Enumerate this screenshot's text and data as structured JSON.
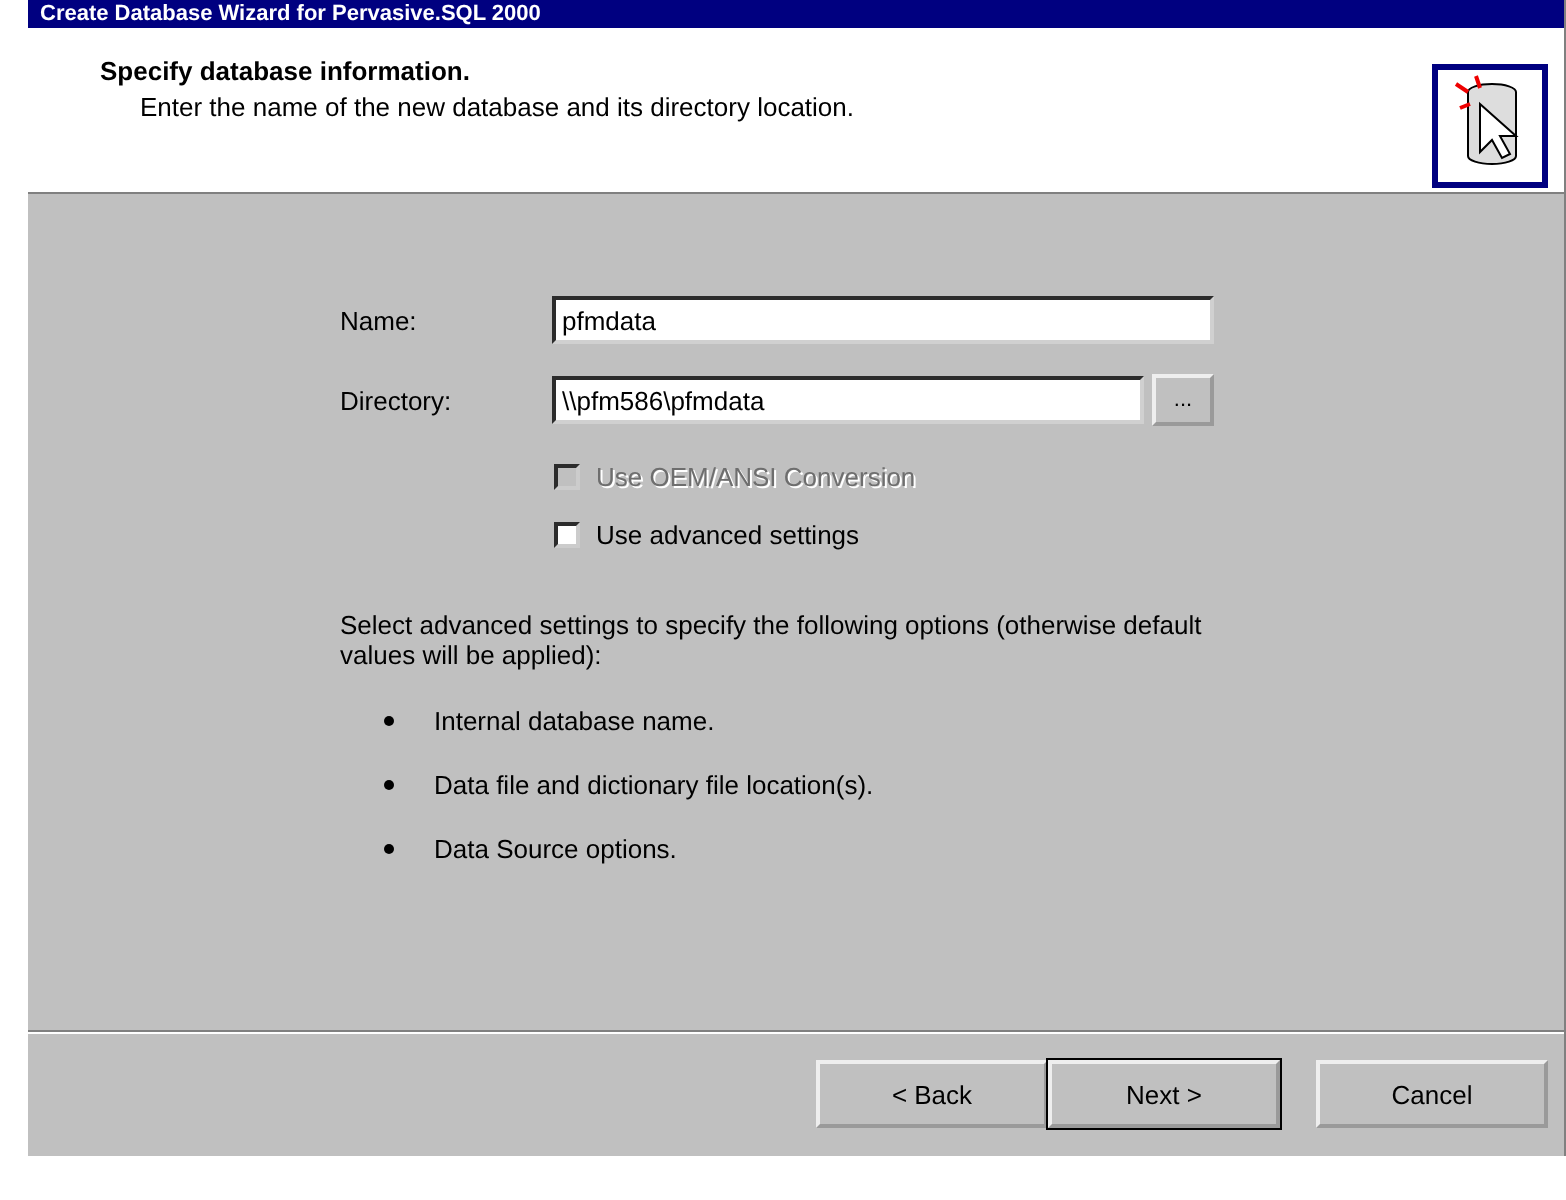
{
  "window": {
    "title": "Create Database Wizard for Pervasive.SQL 2000"
  },
  "header": {
    "title": "Specify database information.",
    "subtitle": "Enter the name of the new database and its directory location."
  },
  "fields": [
    {
      "label": "Name:",
      "value": "pfmdata"
    },
    {
      "label": "Directory:",
      "value": "\\\\pfm586\\pfmdata",
      "browse_label": "..."
    }
  ],
  "options": [
    {
      "label": "Use OEM/ANSI Conversion",
      "checked": false,
      "disabled": true
    },
    {
      "label": "Use advanced settings",
      "checked": false,
      "disabled": false
    }
  ],
  "description": "Select advanced settings to specify the following options (otherwise default values will be applied):",
  "bullets": [
    "Internal database name.",
    "Data file and dictionary file location(s).",
    "Data Source options."
  ],
  "buttons": [
    {
      "label": "< Back",
      "default": false
    },
    {
      "label": "Next >",
      "default": true
    },
    {
      "label": "Cancel",
      "default": false
    }
  ]
}
